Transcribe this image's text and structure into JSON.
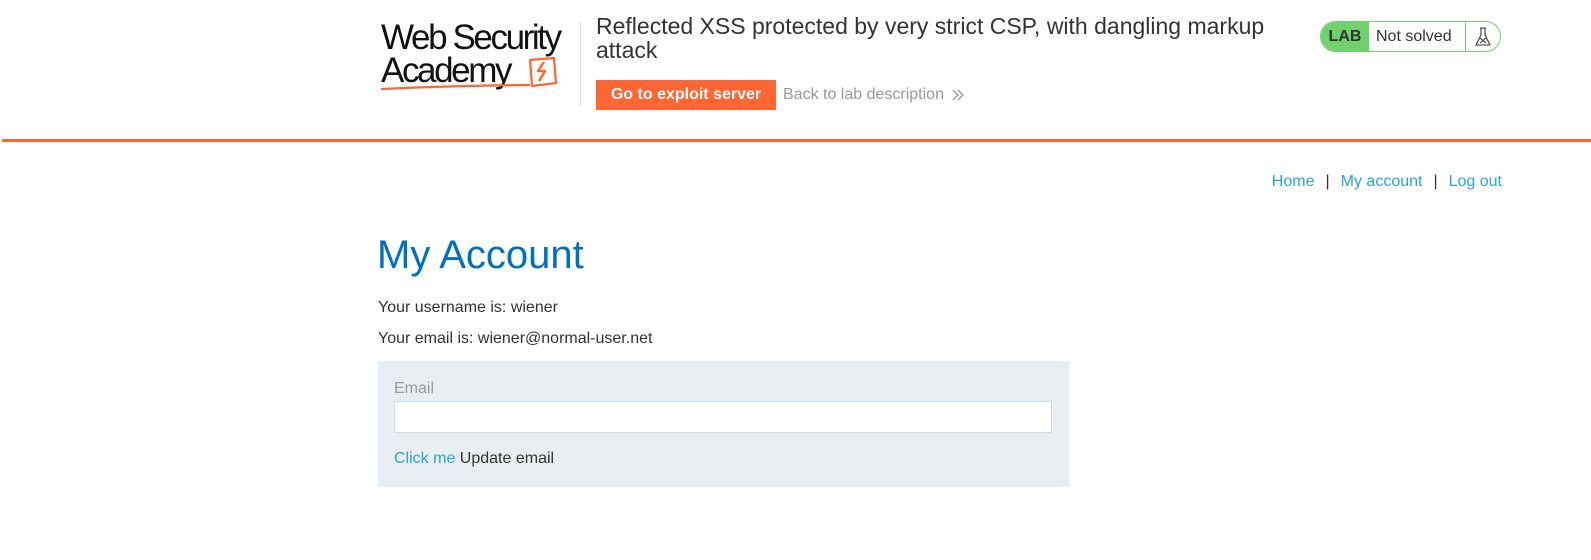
{
  "header": {
    "logo": {
      "line1": "Web Security",
      "line2": "Academy",
      "brand_color": "#ff6633"
    },
    "lab_title": "Reflected XSS protected by very strict CSP, with dangling markup attack",
    "exploit_button_label": "Go to exploit server",
    "back_link_label": "Back to lab description",
    "back_link_icon": "double-chevron-right-icon",
    "lab_status": {
      "badge": "LAB",
      "status": "Not solved",
      "icon": "flask-icon",
      "color": "#70d16d"
    }
  },
  "nav": {
    "items": [
      {
        "label": "Home"
      },
      {
        "label": "My account"
      },
      {
        "label": "Log out"
      }
    ],
    "separator": "|"
  },
  "main": {
    "title": "My Account",
    "username_line": "Your username is: wiener",
    "email_line": "Your email is: wiener@normal-user.net",
    "form": {
      "email_label": "Email",
      "email_value": "",
      "click_me_label": "Click me",
      "update_email_text": "Update email"
    }
  },
  "colors": {
    "accent": "#ff6633",
    "link": "#29a4dc",
    "title": "#0071bc",
    "panel": "#e8eef1"
  }
}
